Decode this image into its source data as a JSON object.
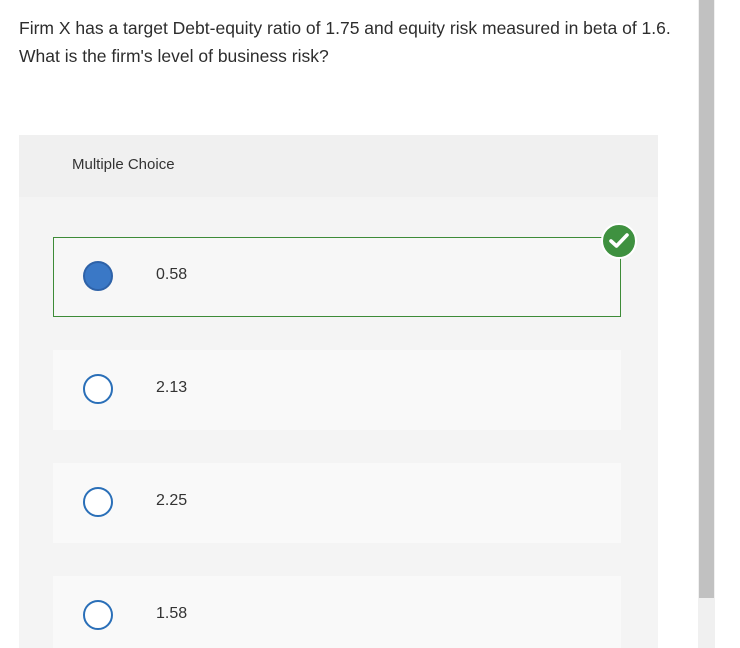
{
  "question": {
    "text": "Firm X has a target Debt-equity ratio of 1.75 and equity risk measured in beta of 1.6. What is the firm's level of business risk?"
  },
  "multiple_choice": {
    "header_label": "Multiple Choice",
    "selected_index": 0,
    "correct_index": 0,
    "options": [
      {
        "label": "0.58",
        "selected": true
      },
      {
        "label": "2.13",
        "selected": false
      },
      {
        "label": "2.25",
        "selected": false
      },
      {
        "label": "1.58",
        "selected": false
      }
    ]
  },
  "icons": {
    "correct_indicator": "check-circle-icon"
  },
  "colors": {
    "selected_radio": "#3a78c6",
    "radio_border": "#2a6fb8",
    "correct_green": "#3f9140",
    "selected_border": "#3d8b37"
  }
}
